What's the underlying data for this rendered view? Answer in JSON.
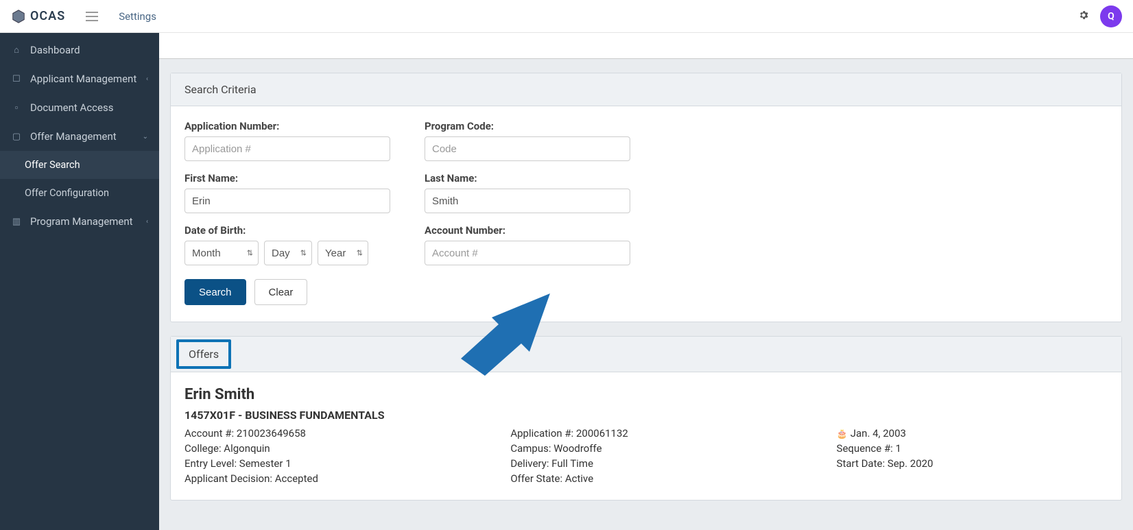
{
  "app": {
    "logo_text": "OCAS"
  },
  "topbar": {
    "breadcrumb": "Settings",
    "avatar_letter": "Q"
  },
  "sidebar": {
    "items": [
      {
        "label": "Dashboard"
      },
      {
        "label": "Applicant Management"
      },
      {
        "label": "Document Access"
      },
      {
        "label": "Offer Management"
      },
      {
        "label": "Offer Search"
      },
      {
        "label": "Offer Configuration"
      },
      {
        "label": "Program Management"
      }
    ]
  },
  "search": {
    "panel_title": "Search Criteria",
    "labels": {
      "app_number": "Application Number:",
      "program_code": "Program Code:",
      "first_name": "First Name:",
      "last_name": "Last Name:",
      "dob": "Date of Birth:",
      "account_number": "Account Number:"
    },
    "placeholders": {
      "app_number": "Application #",
      "program_code": "Code",
      "account_number": "Account #",
      "month": "Month",
      "day": "Day",
      "year": "Year"
    },
    "values": {
      "first_name": "Erin",
      "last_name": "Smith"
    },
    "buttons": {
      "search": "Search",
      "clear": "Clear"
    }
  },
  "results": {
    "tab_label": "Offers",
    "name": "Erin Smith",
    "program": "1457X01F - BUSINESS FUNDAMENTALS",
    "col1": {
      "account": "Account #: 210023649658",
      "college": "College: Algonquin",
      "entry": "Entry Level: Semester 1",
      "decision": "Applicant Decision: Accepted"
    },
    "col2": {
      "application": "Application #: 200061132",
      "campus": "Campus: Woodroffe",
      "delivery": "Delivery: Full Time",
      "state": "Offer State: Active"
    },
    "col3": {
      "dob": "Jan. 4, 2003",
      "sequence": "Sequence #: 1",
      "start": "Start Date: Sep. 2020"
    }
  }
}
